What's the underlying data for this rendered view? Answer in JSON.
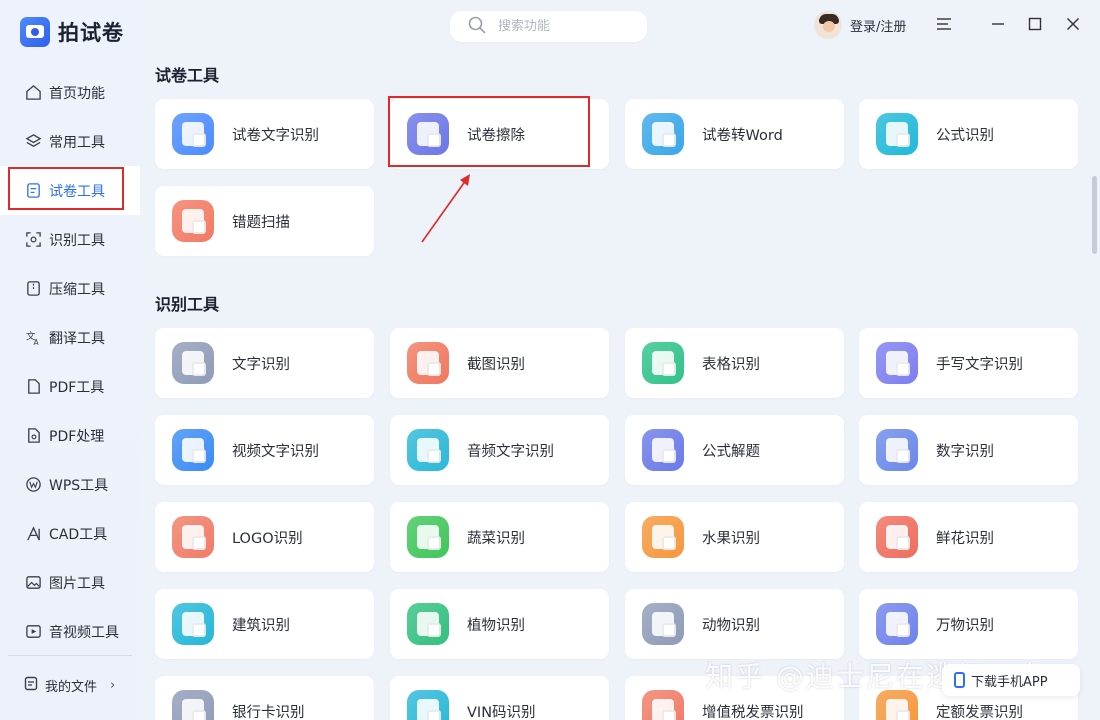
{
  "app": {
    "name": "拍试卷",
    "brand_color": "#2f5fe8",
    "highlight_color": "#e0292b"
  },
  "sidebar": {
    "items": [
      {
        "label": "首页功能",
        "icon": "home-icon"
      },
      {
        "label": "常用工具",
        "icon": "layers-icon"
      },
      {
        "label": "试卷工具",
        "icon": "paper-icon",
        "active": true
      },
      {
        "label": "识别工具",
        "icon": "scan-icon"
      },
      {
        "label": "压缩工具",
        "icon": "compress-icon"
      },
      {
        "label": "翻译工具",
        "icon": "translate-icon"
      },
      {
        "label": "PDF工具",
        "icon": "pdf-icon"
      },
      {
        "label": "PDF处理",
        "icon": "pdf-process-icon"
      },
      {
        "label": "WPS工具",
        "icon": "wps-icon"
      },
      {
        "label": "CAD工具",
        "icon": "cad-icon"
      },
      {
        "label": "图片工具",
        "icon": "image-icon"
      },
      {
        "label": "音视频工具",
        "icon": "av-icon"
      }
    ],
    "my_files": "我的文件"
  },
  "topbar": {
    "search_placeholder": "搜索功能",
    "login_label": "登录/注册"
  },
  "sections": [
    {
      "title": "试卷工具",
      "cards": [
        {
          "label": "试卷文字识别",
          "icon": "paper-ocr-icon",
          "color": "#4b8bff"
        },
        {
          "label": "试卷擦除",
          "icon": "paper-erase-icon",
          "color": "#6b76e8"
        },
        {
          "label": "试卷转Word",
          "icon": "paper-word-icon",
          "color": "#3aa7e9"
        },
        {
          "label": "公式识别",
          "icon": "formula-icon",
          "color": "#1fb9d9"
        },
        {
          "label": "错题扫描",
          "icon": "wrong-question-icon",
          "color": "#f27a63"
        }
      ]
    },
    {
      "title": "识别工具",
      "cards": [
        {
          "label": "文字识别",
          "icon": "text-ocr-icon",
          "color": "#8f9bb8"
        },
        {
          "label": "截图识别",
          "icon": "screenshot-icon",
          "color": "#f1785f"
        },
        {
          "label": "表格识别",
          "icon": "table-icon",
          "color": "#2fc38a"
        },
        {
          "label": "手写文字识别",
          "icon": "handwriting-icon",
          "color": "#7d7ef0"
        },
        {
          "label": "视频文字识别",
          "icon": "video-icon",
          "color": "#3b8cf5"
        },
        {
          "label": "音频文字识别",
          "icon": "audio-icon",
          "color": "#2ab8d8"
        },
        {
          "label": "公式解题",
          "icon": "solve-icon",
          "color": "#6a7ae9"
        },
        {
          "label": "数字识别",
          "icon": "number-icon",
          "color": "#6a88ea"
        },
        {
          "label": "LOGO识别",
          "icon": "logo-icon",
          "color": "#f07b66"
        },
        {
          "label": "蔬菜识别",
          "icon": "vegetable-icon",
          "color": "#3fc65a"
        },
        {
          "label": "水果识别",
          "icon": "fruit-icon",
          "color": "#f6973c"
        },
        {
          "label": "鲜花识别",
          "icon": "flower-icon",
          "color": "#ef6d5d"
        },
        {
          "label": "建筑识别",
          "icon": "building-icon",
          "color": "#25b7d9"
        },
        {
          "label": "植物识别",
          "icon": "plant-icon",
          "color": "#32c07e"
        },
        {
          "label": "动物识别",
          "icon": "animal-icon",
          "color": "#8f9bb8"
        },
        {
          "label": "万物识别",
          "icon": "everything-icon",
          "color": "#6f82ec"
        },
        {
          "label": "银行卡识别",
          "icon": "bankcard-icon",
          "color": "#8f9bb8"
        },
        {
          "label": "VIN码识别",
          "icon": "vin-icon",
          "color": "#2ab8d8"
        },
        {
          "label": "增值税发票识别",
          "icon": "vat-invoice-icon",
          "color": "#f07b66"
        },
        {
          "label": "定额发票识别",
          "icon": "quota-invoice-icon",
          "color": "#f6973c"
        }
      ]
    }
  ],
  "watermark": "知乎 @迪士尼在逃打工人",
  "download_app": "下载手机APP"
}
